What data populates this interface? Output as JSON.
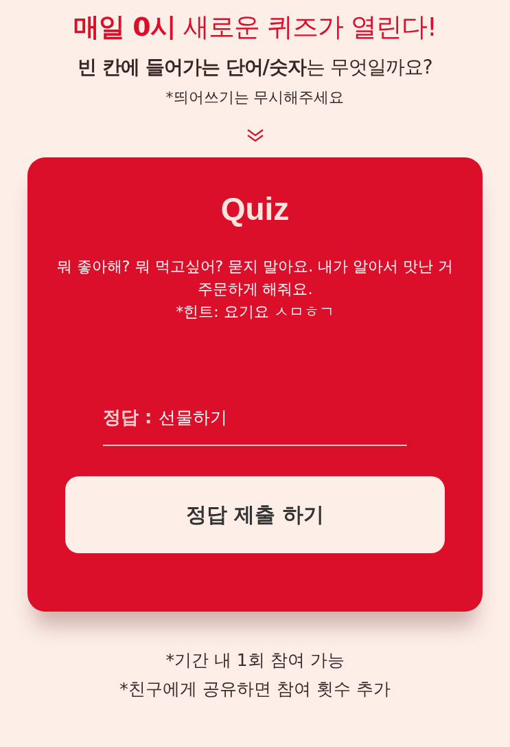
{
  "headline": "**매일 0시** 새로운 퀴즈가 열린다!",
  "subtitle": "**빈 칸에 들어가는 단어/숫자**는 무엇일까요?",
  "note": "*띄어쓰기는 무시해주세요",
  "card": {
    "title": "Quiz",
    "question_lines": [
      "뭐 좋아해? 뭐 먹고싶어? 묻지 말아요. 내가 알아서 맛난 거 주문하게 해줘요.",
      "*힌트: 요기요 ㅅㅁㅎㄱ"
    ],
    "answer": {
      "label": "정답 :",
      "value": "선물하기"
    },
    "submit_button": "정답 제출 하기"
  },
  "footnotes": [
    "*기간 내 1회 참여 가능",
    "*친구에게 공유하면 참여 횟수 추가"
  ]
}
